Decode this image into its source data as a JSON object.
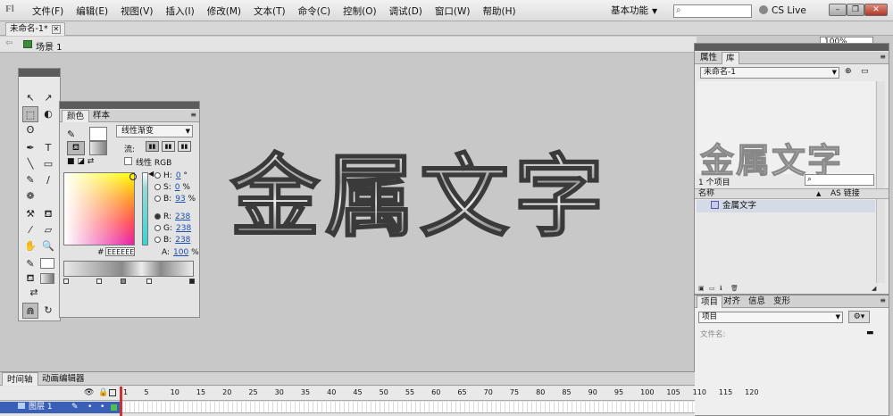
{
  "menu": {
    "logo": "Fl",
    "items": [
      "文件(F)",
      "编辑(E)",
      "视图(V)",
      "插入(I)",
      "修改(M)",
      "文本(T)",
      "命令(C)",
      "控制(O)",
      "调试(D)",
      "窗口(W)",
      "帮助(H)"
    ],
    "workspace": "基本功能",
    "cs_live": "CS Live"
  },
  "document": {
    "tab_title": "未命名-1*",
    "scene": "场景 1",
    "zoom": "100%"
  },
  "stage": {
    "text": "金属文字"
  },
  "color_panel": {
    "tabs": [
      "颜色",
      "样本"
    ],
    "type": "线性渐变",
    "flow_label": "流:",
    "linear_rgb_label": "线性 RGB",
    "hsb": [
      {
        "label": "H:",
        "value": "0",
        "unit": "°"
      },
      {
        "label": "S:",
        "value": "0",
        "unit": "%"
      },
      {
        "label": "B:",
        "value": "93",
        "unit": "%"
      }
    ],
    "rgb": [
      {
        "label": "R:",
        "value": "238"
      },
      {
        "label": "G:",
        "value": "238"
      },
      {
        "label": "B:",
        "value": "238"
      }
    ],
    "hex_label": "#",
    "hex": "EEEEEE",
    "alpha_label": "A:",
    "alpha_value": "100",
    "alpha_unit": "%"
  },
  "library_panel": {
    "tabs": [
      "属性",
      "库"
    ],
    "document": "未命名-1",
    "preview_text": "金属文字",
    "item_count": "1 个项目",
    "col_name": "名称",
    "col_linkage": "AS 链接",
    "items": [
      {
        "name": "金属文字"
      }
    ]
  },
  "project_panel": {
    "tabs": [
      "项目",
      "对齐",
      "信息",
      "变形"
    ],
    "project_select": "项目",
    "file_name_label": "文件名:"
  },
  "timeline": {
    "tabs": [
      "时间轴",
      "动画编辑器"
    ],
    "ruler": [
      "1",
      "5",
      "10",
      "15",
      "20",
      "25",
      "30",
      "35",
      "40",
      "45",
      "50",
      "55",
      "60",
      "65",
      "70",
      "75",
      "80",
      "85",
      "90",
      "95",
      "100",
      "105",
      "110",
      "115",
      "120"
    ],
    "layer_name": "图层 1"
  }
}
